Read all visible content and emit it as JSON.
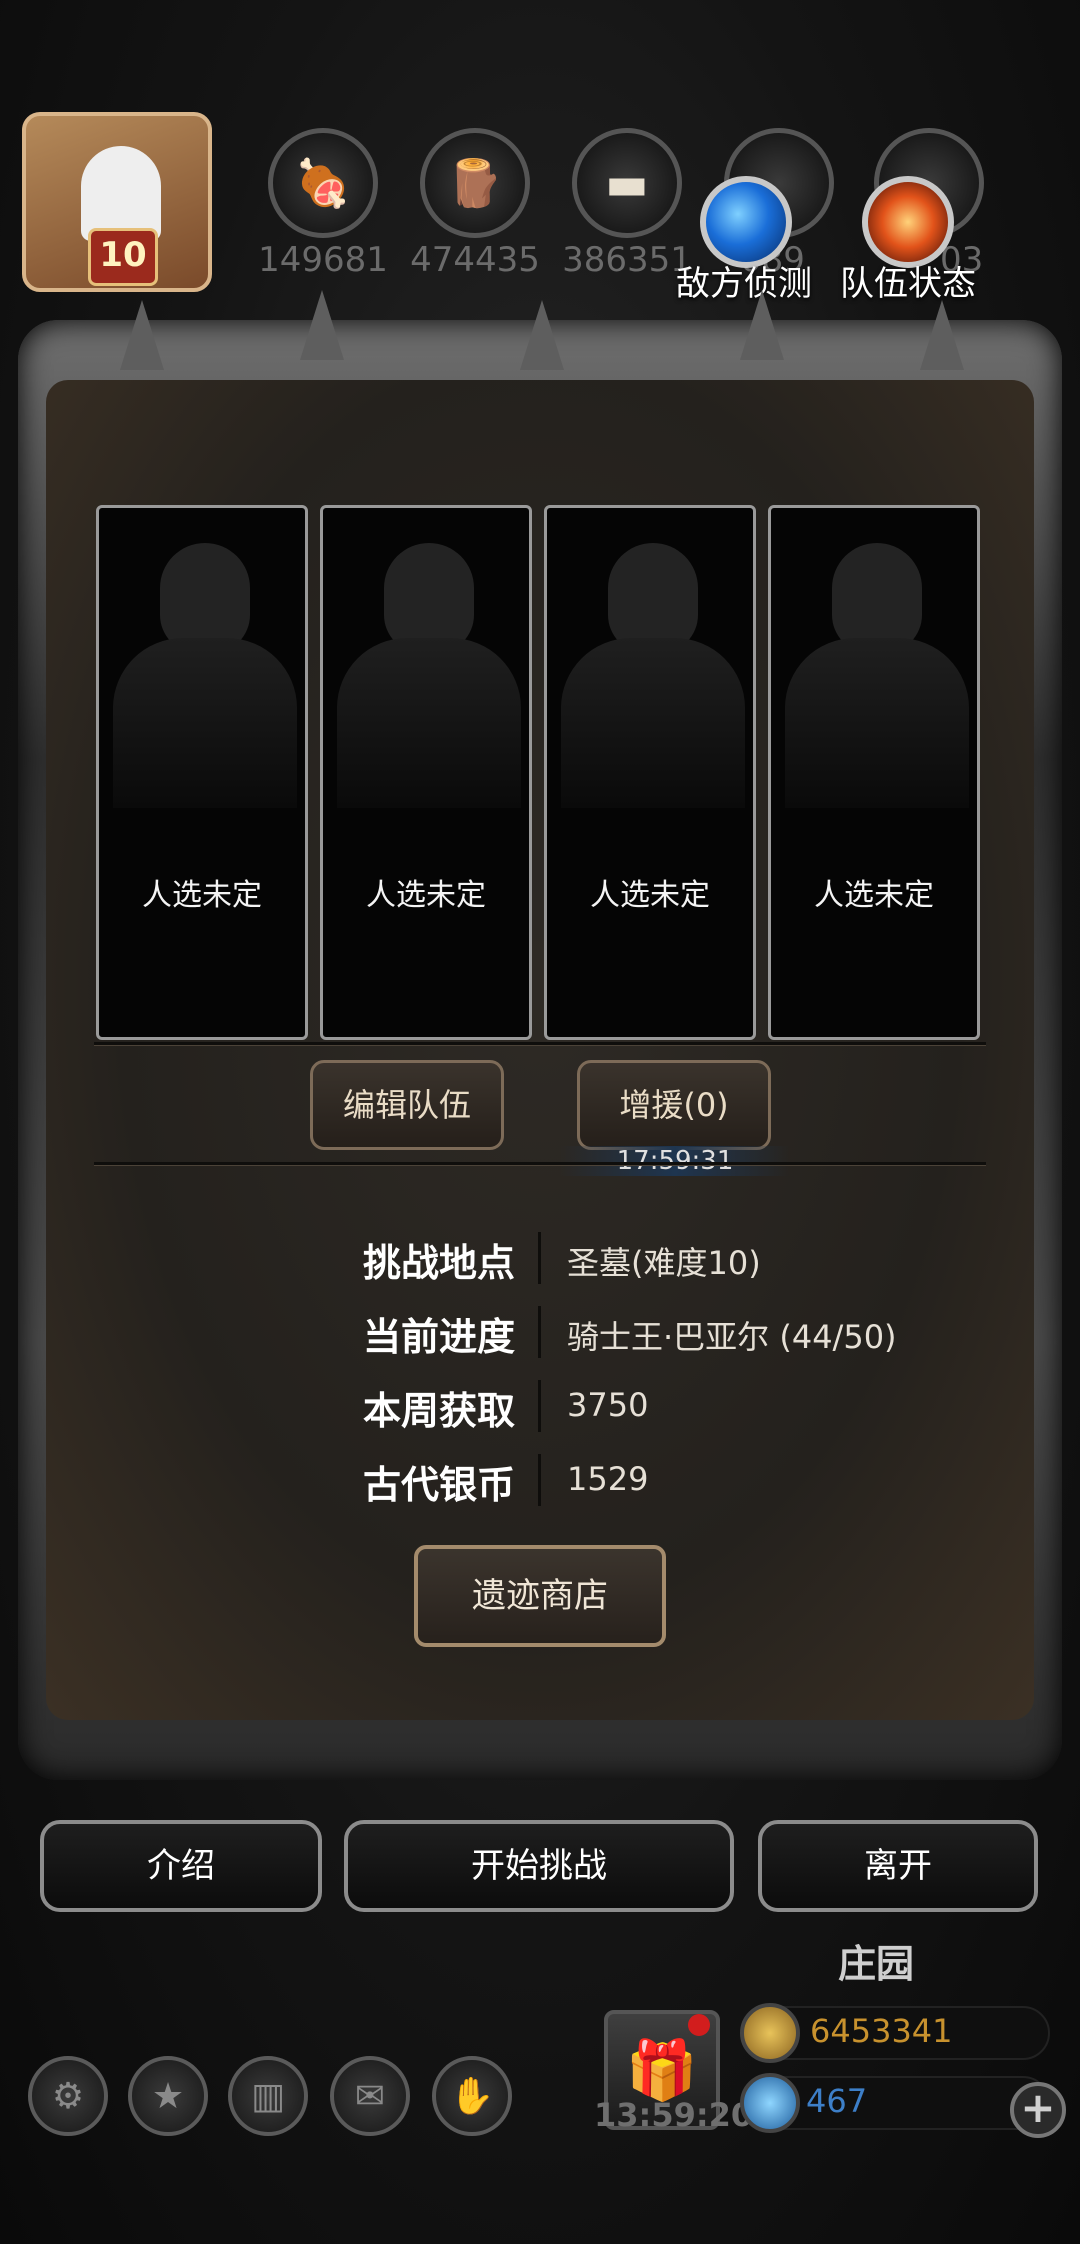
{
  "header": {
    "player_level": "10",
    "resources": [
      {
        "icon": "meat-icon",
        "value": "149681"
      },
      {
        "icon": "wood-icon",
        "value": "474435"
      },
      {
        "icon": "iron-icon",
        "value": "386351"
      },
      {
        "icon": "crystal-icon",
        "value": "089"
      },
      {
        "icon": "stone-icon",
        "value": "03"
      }
    ],
    "enemy_scout_label": "敌方侦测",
    "team_status_label": "队伍状态"
  },
  "team": {
    "slots": [
      {
        "label": "人选未定"
      },
      {
        "label": "人选未定"
      },
      {
        "label": "人选未定"
      },
      {
        "label": "人选未定"
      }
    ],
    "edit_label": "编辑队伍",
    "reinforce_label": "增援(0)",
    "reinforce_timer": "17:59:31"
  },
  "info": {
    "rows": [
      {
        "label": "挑战地点",
        "value": "圣墓(难度10)"
      },
      {
        "label": "当前进度",
        "value": "骑士王·巴亚尔 (44/50)"
      },
      {
        "label": "本周获取",
        "value": "3750"
      },
      {
        "label": "古代银币",
        "value": "1529"
      }
    ],
    "shop_label": "遗迹商店"
  },
  "actions": {
    "intro_label": "介绍",
    "start_label": "开始挑战",
    "leave_label": "离开"
  },
  "footer": {
    "estate_label": "庄园",
    "nav_icons": [
      "gear-icon",
      "star-icon",
      "ranking-icon",
      "mail-icon",
      "handshake-icon"
    ],
    "gift_timer": "13:59:20",
    "gold_amount": "6453341",
    "gem_amount": "467",
    "gold_color": "#c8922e",
    "gem_color": "#3d7fc8"
  }
}
